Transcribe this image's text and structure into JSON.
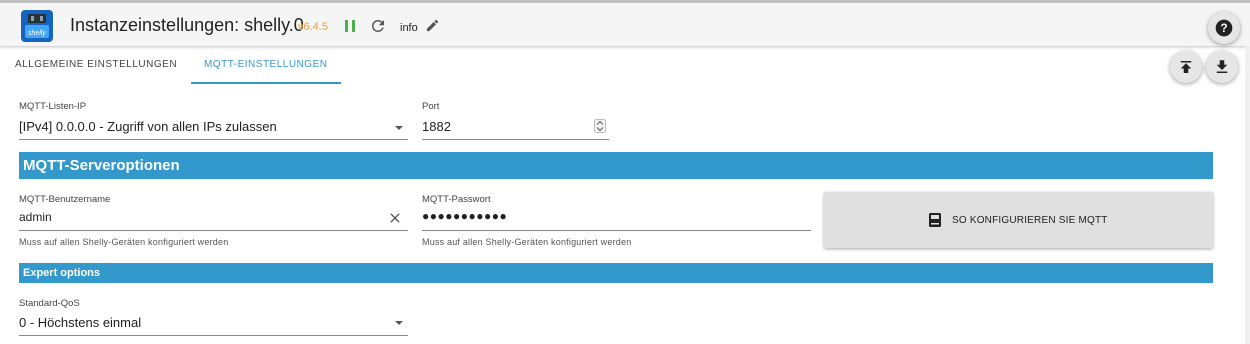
{
  "header": {
    "title": "Instanzeinstellungen: shelly.0",
    "version": "v6.4.5",
    "loglevel": "info",
    "help_icon": "help-icon"
  },
  "tabs": [
    {
      "label": "ALLGEMEINE EINSTELLUNGEN",
      "active": false
    },
    {
      "label": "MQTT-EINSTELLUNGEN",
      "active": true
    }
  ],
  "listen_ip": {
    "label": "MQTT-Listen-IP",
    "value": "[IPv4] 0.0.0.0 - Zugriff von allen IPs zulassen"
  },
  "port": {
    "label": "Port",
    "value": "1882"
  },
  "server_options": {
    "title": "MQTT-Serveroptionen",
    "username": {
      "label": "MQTT-Benutzername",
      "value": "admin",
      "helper": "Muss auf allen Shelly-Geräten konfiguriert werden"
    },
    "password": {
      "label": "MQTT-Passwort",
      "value": "●●●●●●●●●●●",
      "helper": "Muss auf allen Shelly-Geräten konfiguriert werden"
    },
    "howto_button": "SO KONFIGURIEREN SIE MQTT"
  },
  "expert": {
    "title": "Expert options",
    "qos": {
      "label": "Standard-QoS",
      "value": "0 - Höchstens einmal"
    }
  },
  "colors": {
    "accent": "#3399cc",
    "version": "#f0a030",
    "pause": "#4caf50"
  }
}
